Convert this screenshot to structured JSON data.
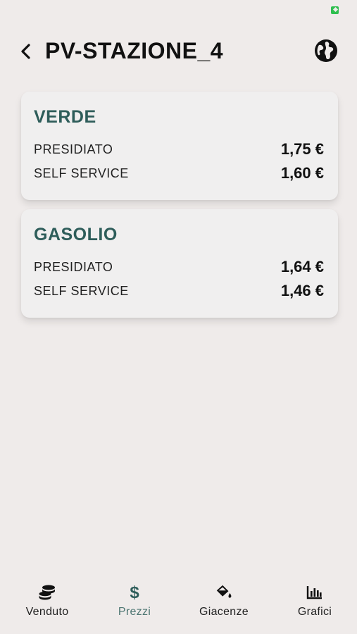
{
  "header": {
    "title": "PV-STAZIONE_4"
  },
  "cards": [
    {
      "title": "VERDE",
      "rows": [
        {
          "label": "PRESIDIATO",
          "price": "1,75 €"
        },
        {
          "label": "SELF SERVICE",
          "price": "1,60 €"
        }
      ]
    },
    {
      "title": "GASOLIO",
      "rows": [
        {
          "label": "PRESIDIATO",
          "price": "1,64 €"
        },
        {
          "label": "SELF SERVICE",
          "price": "1,46 €"
        }
      ]
    }
  ],
  "tabs": [
    {
      "label": "Venduto",
      "icon": "coins-icon",
      "active": false
    },
    {
      "label": "Prezzi",
      "icon": "dollar-icon",
      "active": true
    },
    {
      "label": "Giacenze",
      "icon": "paint-bucket-icon",
      "active": false
    },
    {
      "label": "Grafici",
      "icon": "bar-chart-icon",
      "active": false
    }
  ],
  "colors": {
    "background": "#efebea",
    "card_background": "#f0efef",
    "card_title": "#2e5d5a",
    "active_tab": "#4c7571",
    "battery": "#2fbf4f"
  }
}
